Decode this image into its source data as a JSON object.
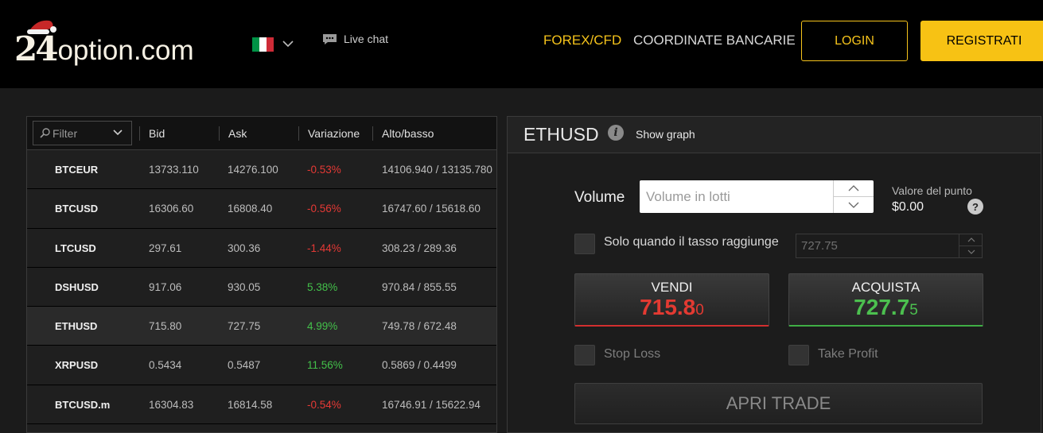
{
  "header": {
    "logo_num": "24",
    "logo_text": "option.com",
    "language_flag": "italy-flag",
    "live_chat": "Live chat",
    "nav": {
      "forex": "FOREX/CFD",
      "bank": "COORDINATE BANCARIE"
    },
    "login": "LOGIN",
    "register": "REGISTRATI"
  },
  "colors": {
    "accent": "#f5c31b",
    "negative": "#e53935",
    "positive": "#43c04a",
    "background": "#1b1b1b"
  },
  "table": {
    "filter_label": "Filter",
    "columns": [
      "Bid",
      "Ask",
      "Variazione",
      "Alto/basso"
    ],
    "rows": [
      {
        "symbol": "BTCEUR",
        "bid": "13733.110",
        "ask": "14276.100",
        "change": "-0.53%",
        "highlow": "14106.940 / 13135.780"
      },
      {
        "symbol": "BTCUSD",
        "bid": "16306.60",
        "ask": "16808.40",
        "change": "-0.56%",
        "highlow": "16747.60 / 15618.60"
      },
      {
        "symbol": "LTCUSD",
        "bid": "297.61",
        "ask": "300.36",
        "change": "-1.44%",
        "highlow": "308.23 / 289.36"
      },
      {
        "symbol": "DSHUSD",
        "bid": "917.06",
        "ask": "930.05",
        "change": "5.38%",
        "highlow": "970.84 / 855.55"
      },
      {
        "symbol": "ETHUSD",
        "bid": "715.80",
        "ask": "727.75",
        "change": "4.99%",
        "highlow": "749.78 / 672.48"
      },
      {
        "symbol": "XRPUSD",
        "bid": "0.5434",
        "ask": "0.5487",
        "change": "11.56%",
        "highlow": "0.5869 / 0.4499"
      },
      {
        "symbol": "BTCUSD.m",
        "bid": "16304.83",
        "ask": "16814.58",
        "change": "-0.54%",
        "highlow": "16746.91 / 15622.94"
      }
    ]
  },
  "trade": {
    "symbol": "ETHUSD",
    "show_graph": "Show graph",
    "volume_label": "Volume",
    "volume_placeholder": "Volume in lotti",
    "point_value_label": "Valore del punto",
    "point_value": "$0.00",
    "rate_condition_label": "Solo quando il tasso raggiunge",
    "rate_value": "727.75",
    "sell": {
      "label": "VENDI",
      "price_main": "715.8",
      "price_small": "0"
    },
    "buy": {
      "label": "ACQUISTA",
      "price_main": "727.7",
      "price_small": "5"
    },
    "stop_loss": "Stop Loss",
    "take_profit": "Take Profit",
    "open_trade": "APRI TRADE"
  }
}
